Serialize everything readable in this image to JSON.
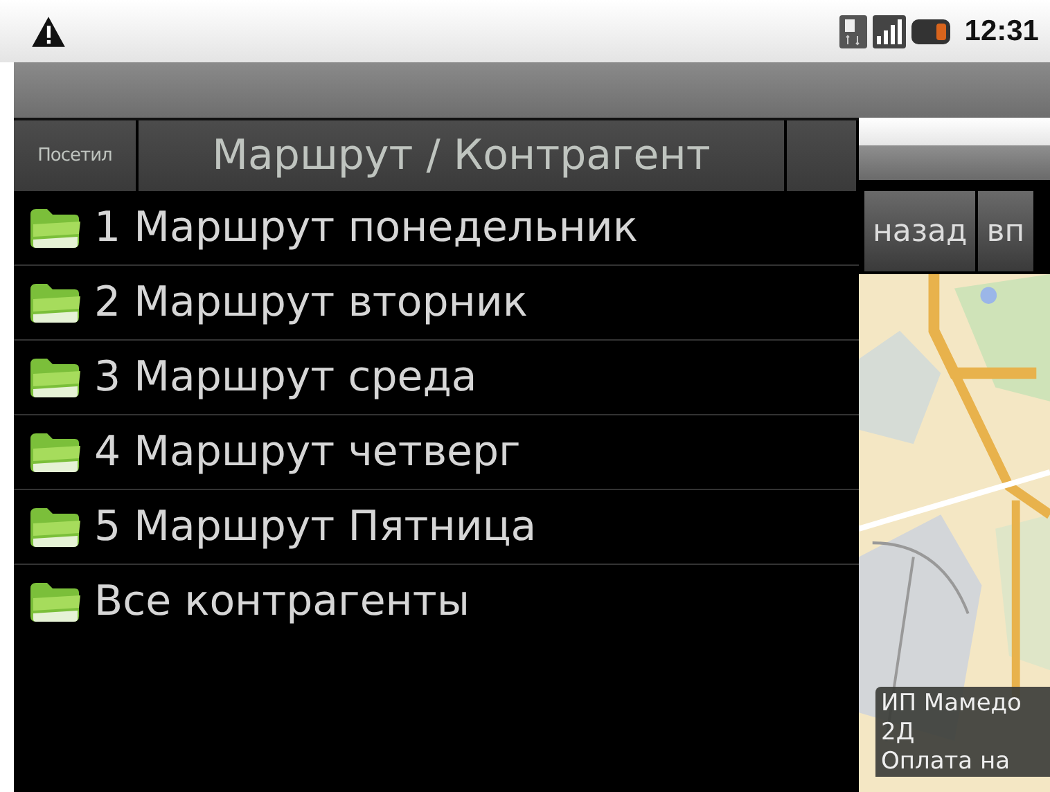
{
  "status_bar": {
    "time": "12:31"
  },
  "header": {
    "tabs": [
      {
        "label": "Посетил",
        "kind": "small"
      },
      {
        "label": "Маршрут / Контрагент",
        "kind": "title"
      },
      {
        "kind": "blank"
      }
    ]
  },
  "routes": [
    {
      "label": "1 Маршрут понедельник"
    },
    {
      "label": "2 Маршрут вторник"
    },
    {
      "label": "3 Маршрут среда"
    },
    {
      "label": "4 Маршрут четверг"
    },
    {
      "label": "5 Маршрут Пятница"
    },
    {
      "label": "Все контрагенты"
    }
  ],
  "map_window": {
    "buttons": [
      "назад",
      "вп"
    ],
    "callout": {
      "lines": [
        "ИП Мамедо",
        "2Д",
        "Оплата на"
      ]
    }
  }
}
